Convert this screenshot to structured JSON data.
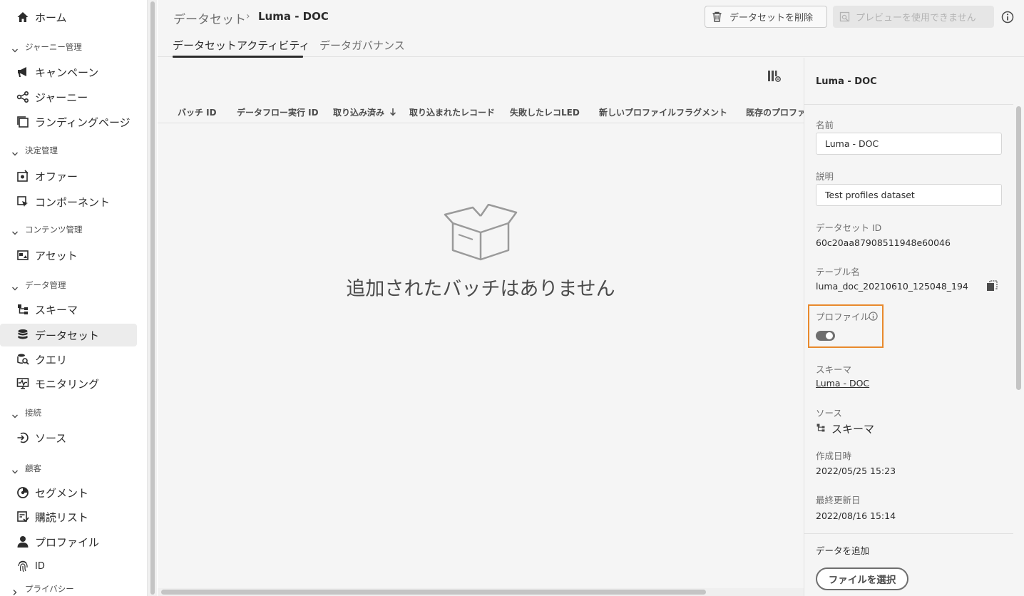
{
  "sidebar": {
    "home": "ホーム",
    "groups": {
      "journey": "ジャーニー管理",
      "decision": "決定管理",
      "content": "コンテンツ管理",
      "data": "データ管理",
      "connections": "接続",
      "customers": "顧客",
      "privacy": "プライバシー"
    },
    "items": {
      "campaign": "キャンペーン",
      "journey": "ジャーニー",
      "landing": "ランディングページ",
      "offer": "オファー",
      "component": "コンポーネント",
      "asset": "アセット",
      "schema": "スキーマ",
      "dataset": "データセット",
      "query": "クエリ",
      "monitoring": "モニタリング",
      "source": "ソース",
      "segment": "セグメント",
      "subscription": "購読リスト",
      "profile": "プロファイル",
      "id": "ID"
    }
  },
  "header": {
    "breadcrumb_root": "データセット",
    "breadcrumb_sep": "›",
    "breadcrumb_current": "Luma - DOC",
    "delete_label": "データセットを削除",
    "preview_label": "プレビューを使用できません",
    "tabs": [
      "データセットアクティビティ",
      "データガバナンス"
    ]
  },
  "table": {
    "columns": [
      "バッチ ID",
      "データフロー実行 ID",
      "取り込み済み",
      "取り込まれたレコード",
      "失敗したレコLED",
      "新しいプロファイルフラグメント",
      "既存のプロファ"
    ],
    "empty_message": "追加されたバッチはありません"
  },
  "panel": {
    "title": "Luma - DOC",
    "name_label": "名前",
    "name_value": "Luma - DOC",
    "desc_label": "説明",
    "desc_value": "Test profiles dataset",
    "id_label": "データセット ID",
    "id_value": "60c20aa87908511948e60046",
    "table_label": "テーブル名",
    "table_value": "luma_doc_20210610_125048_194",
    "profile_label": "プロファイル",
    "schema_label": "スキーマ",
    "schema_value": "Luma - DOC",
    "source_label": "ソース",
    "source_value": "スキーマ",
    "created_label": "作成日時",
    "created_value": "2022/05/25 15:23",
    "modified_label": "最終更新日",
    "modified_value": "2022/08/16 15:14",
    "add_data_label": "データを追加",
    "file_button": "ファイルを選択"
  },
  "colors": {
    "highlight": "#e8892c",
    "toggle": "#6e6e6e",
    "active_nav": "#ececec"
  }
}
